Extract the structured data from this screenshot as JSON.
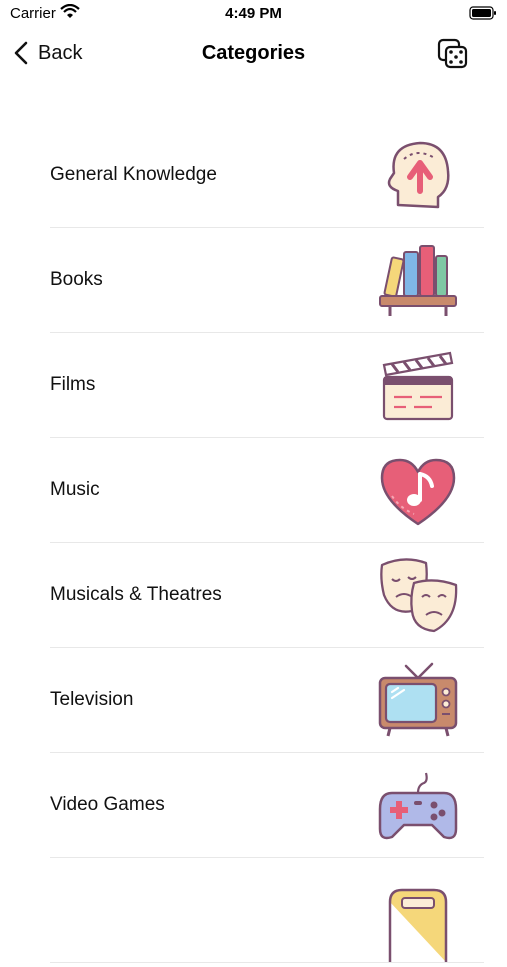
{
  "status_bar": {
    "carrier": "Carrier",
    "time": "4:49 PM"
  },
  "nav": {
    "back_label": "Back",
    "title": "Categories",
    "right_icon": "dice-icon"
  },
  "categories": [
    {
      "label": "General Knowledge",
      "icon": "head-arrow-up-icon"
    },
    {
      "label": "Books",
      "icon": "bookshelf-icon"
    },
    {
      "label": "Films",
      "icon": "clapperboard-icon"
    },
    {
      "label": "Music",
      "icon": "heart-music-note-icon"
    },
    {
      "label": "Musicals & Theatres",
      "icon": "theatre-masks-icon"
    },
    {
      "label": "Television",
      "icon": "retro-tv-icon"
    },
    {
      "label": "Video Games",
      "icon": "gamepad-icon"
    }
  ],
  "colors": {
    "outline": "#7a4f6e",
    "pink": "#e75f78",
    "cream": "#fbecd6",
    "blue": "#7fb6e6",
    "yellow": "#f5d77a",
    "green": "#7fc8a4",
    "lavender": "#b0b9e8",
    "brown": "#c88a6c"
  }
}
